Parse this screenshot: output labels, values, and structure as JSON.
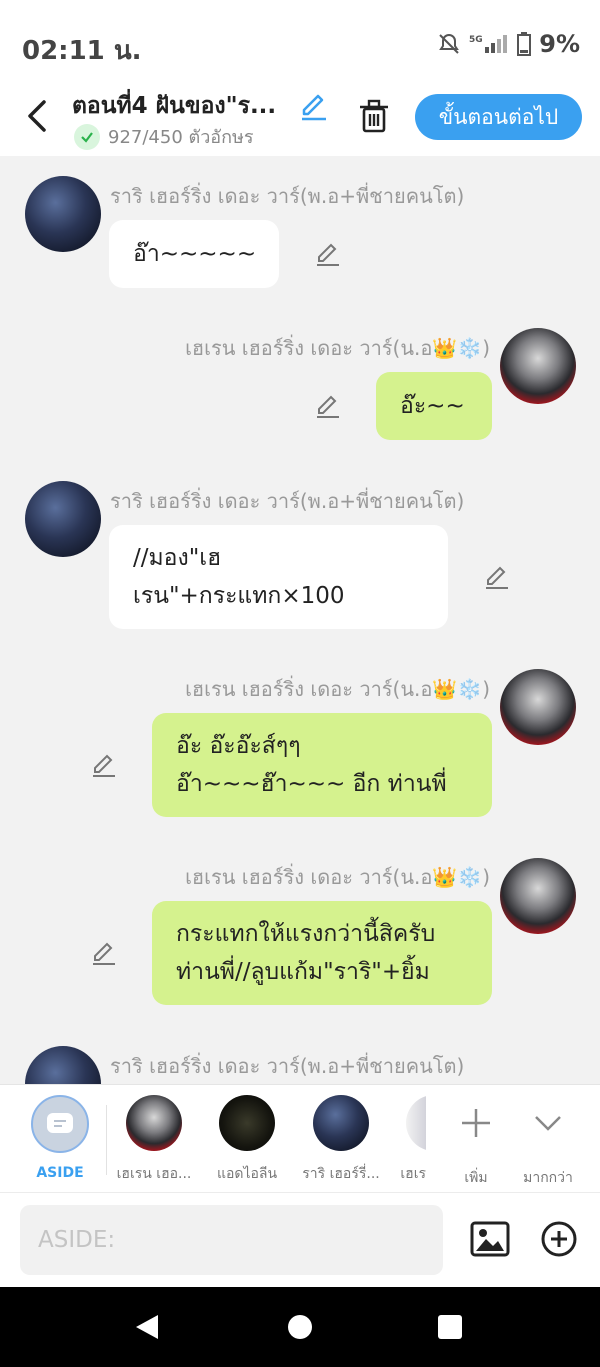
{
  "status": {
    "time": "02:11 น.",
    "battery": "9%"
  },
  "header": {
    "title": "ตอนที่4 ฝันของ\"ร...",
    "char_count": "927/450 ตัวอักษร",
    "next_label": "ขั้นตอนต่อไป"
  },
  "messages": [
    {
      "sender": "ราริ เฮอร์ริ่ง เดอะ วาร์(พ.อ+พี่ชายคนโต)",
      "lines": [
        "อ๊า~~~~~"
      ]
    },
    {
      "sender": "เฮเรน เฮอร์ริ่ง เดอะ วาร์(น.อ👑❄️)",
      "lines": [
        "อ๊ะ~~"
      ]
    },
    {
      "sender": "ราริ เฮอร์ริ่ง เดอะ วาร์(พ.อ+พี่ชายคนโต)",
      "lines": [
        "//มอง\"เฮ",
        "เรน\"+กระแทก×100"
      ]
    },
    {
      "sender": "เฮเรน เฮอร์ริ่ง เดอะ วาร์(น.อ👑❄️)",
      "lines": [
        "อ๊ะ อ๊ะอ๊ะส์ๆๆ",
        "อ๊า~~~ฮ๊า~~~ อีก ท่านพี่"
      ]
    },
    {
      "sender": "เฮเรน เฮอร์ริ่ง เดอะ วาร์(น.อ👑❄️)",
      "lines": [
        "กระแทกให้แรงกว่านี้สิครับ",
        "ท่านพี่//ลูบแก้ม\"ราริ\"+ยิ้ม"
      ]
    },
    {
      "sender": "ราริ เฮอร์ริ่ง เดอะ วาร์(พ.อ+พี่ชายคนโต)",
      "lines": []
    }
  ],
  "characters": [
    {
      "label": "ASIDE"
    },
    {
      "label": "เฮเรน เฮอ..."
    },
    {
      "label": "แอดไอลีน"
    },
    {
      "label": "ราริ เฮอร์รี่..."
    },
    {
      "label": "เฮเร"
    }
  ],
  "actions": {
    "add_label": "เพิ่ม",
    "more_label": "มากกว่า"
  },
  "input": {
    "placeholder": "ASIDE:"
  },
  "colors": {
    "accent": "#3aa0f0",
    "bubble_green": "#d5f28e",
    "bubble_white": "#ffffff"
  }
}
